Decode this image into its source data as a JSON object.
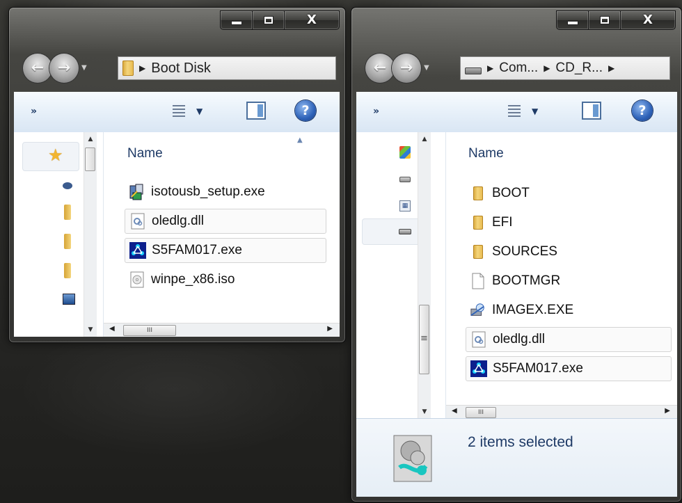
{
  "left_window": {
    "controls": {
      "minimize": "minimize",
      "maximize": "maximize",
      "close": "X"
    },
    "breadcrumb": [
      "Boot Disk"
    ],
    "toolbar": {
      "overflow": "»"
    },
    "column_header": "Name",
    "files": [
      {
        "name": "isotousb_setup.exe",
        "icon": "installer-icon",
        "selected": false
      },
      {
        "name": "oledlg.dll",
        "icon": "dll-icon",
        "selected": true
      },
      {
        "name": "S5FAM017.exe",
        "icon": "exe-app-icon",
        "selected": true
      },
      {
        "name": "winpe_x86.iso",
        "icon": "iso-disc-icon",
        "selected": false
      }
    ],
    "hscroll_grip": "III"
  },
  "right_window": {
    "controls": {
      "minimize": "minimize",
      "maximize": "maximize",
      "close": "X"
    },
    "breadcrumb": [
      "Com...",
      "CD_R..."
    ],
    "toolbar": {
      "overflow": "»"
    },
    "column_header": "Name",
    "files": [
      {
        "name": "BOOT",
        "icon": "folder-icon",
        "selected": false
      },
      {
        "name": "EFI",
        "icon": "folder-icon",
        "selected": false
      },
      {
        "name": "SOURCES",
        "icon": "folder-icon",
        "selected": false
      },
      {
        "name": "BOOTMGR",
        "icon": "file-icon",
        "selected": false
      },
      {
        "name": "IMAGEX.EXE",
        "icon": "imagex-icon",
        "selected": false
      },
      {
        "name": "oledlg.dll",
        "icon": "dll-icon",
        "selected": true
      },
      {
        "name": "S5FAM017.exe",
        "icon": "exe-app-icon",
        "selected": true
      }
    ],
    "hscroll_grip": "III",
    "vscroll_grip": "≡",
    "status": "2 items selected"
  },
  "colors": {
    "selection_border": "#d4d4d4",
    "toolbar_top": "#f7fbfe",
    "toolbar_bottom": "#d9e6f4",
    "link_blue": "#1e3a66"
  }
}
